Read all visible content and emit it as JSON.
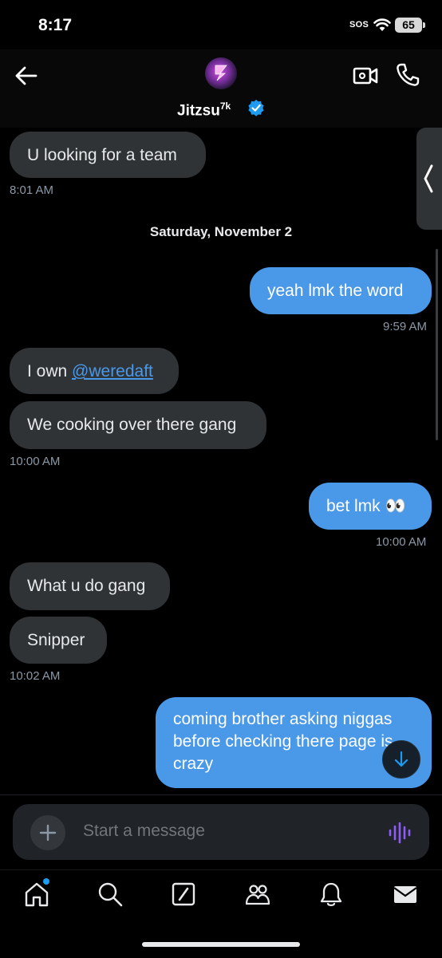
{
  "status_bar": {
    "time": "8:17",
    "sos": "SOS",
    "battery": "65"
  },
  "header": {
    "contact_name": "Jitzsu",
    "contact_superscript": "7k",
    "icons": [
      "back-arrow-icon",
      "verified-badge-icon",
      "video-call-icon",
      "phone-icon"
    ]
  },
  "messages": [
    {
      "side": "in",
      "text": "U looking for a team",
      "time": "8:01 AM"
    },
    {
      "date_separator": "Saturday, November 2"
    },
    {
      "side": "out",
      "text": "yeah lmk the word",
      "time": "9:59 AM"
    },
    {
      "side": "in",
      "text_prefix": "I own ",
      "mention": "@weredaft"
    },
    {
      "side": "in",
      "text": "We cooking over there gang",
      "time": "10:00 AM"
    },
    {
      "side": "out",
      "text": "bet lmk 👀",
      "time": "10:00 AM"
    },
    {
      "side": "in",
      "text": "What u do gang"
    },
    {
      "side": "in",
      "text": "Snipper",
      "time": "10:02 AM"
    },
    {
      "side": "out",
      "lines": [
        "coming brother asking niggas",
        "before checking there page is",
        "crazy"
      ]
    }
  ],
  "composer": {
    "placeholder": "Start a message"
  },
  "tab_bar": {
    "items": [
      "home",
      "search",
      "grok",
      "communities",
      "notifications",
      "messages"
    ]
  },
  "colors": {
    "accent": "#1d9bf0",
    "outgoing_bubble": "#4a98e8",
    "incoming_bubble": "#2f3336",
    "voice_icon": "#8b5cf6"
  }
}
